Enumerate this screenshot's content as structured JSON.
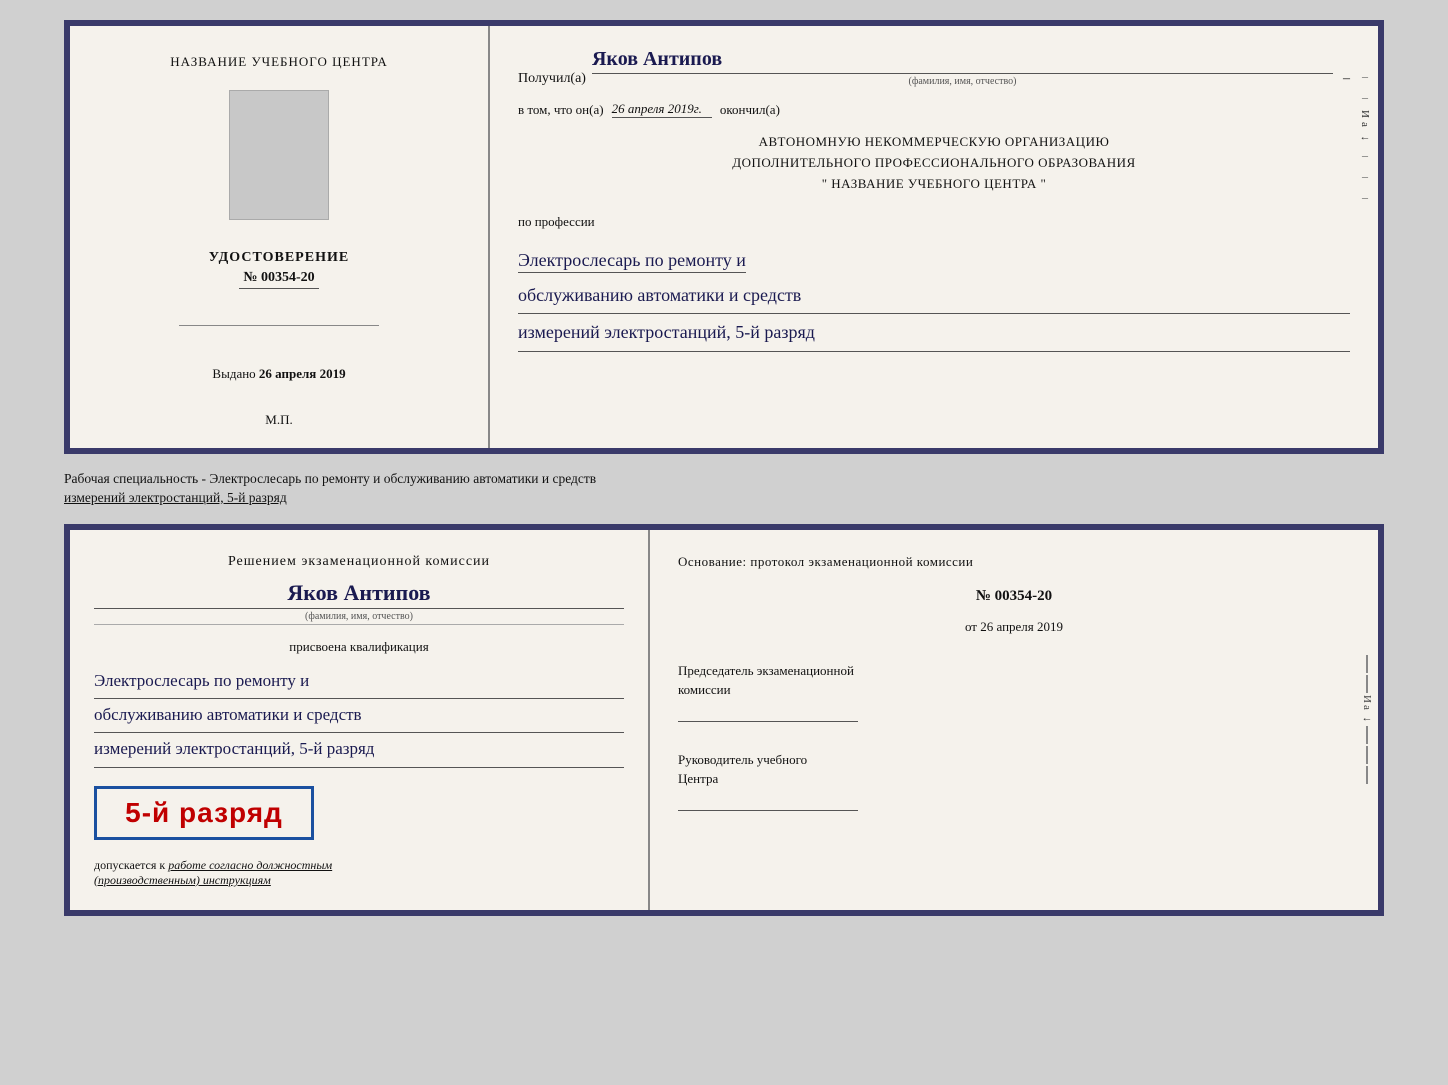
{
  "top_left": {
    "center_title": "НАЗВАНИЕ УЧЕБНОГО ЦЕНТРА",
    "udostoverenie_label": "УДОСТОВЕРЕНИЕ",
    "udostoverenie_number": "№ 00354-20",
    "vydano_label": "Выдано",
    "vydano_date": "26 апреля 2019",
    "mp_label": "М.П."
  },
  "top_right": {
    "poluchil_label": "Получил(а)",
    "poluchil_name": "Яков Антипов",
    "fio_subtitle": "(фамилия, имя, отчество)",
    "vtom_prefix": "в том, что он(а)",
    "vtom_date": "26 апреля 2019г.",
    "vtom_suffix": "окончил(а)",
    "org_line1": "АВТОНОМНУЮ НЕКОММЕРЧЕСКУЮ ОРГАНИЗАЦИЮ",
    "org_line2": "ДОПОЛНИТЕЛЬНОГО ПРОФЕССИОНАЛЬНОГО ОБРАЗОВАНИЯ",
    "org_line3": "\"   НАЗВАНИЕ УЧЕБНОГО ЦЕНТРА   \"",
    "po_professii": "по профессии",
    "profession_line1": "Электрослесарь по ремонту и",
    "profession_line2": "обслуживанию автоматики и средств",
    "profession_line3": "измерений электростанций, 5-й разряд",
    "deco_chars": [
      "И",
      "а",
      "←"
    ]
  },
  "middle_text": {
    "line1": "Рабочая специальность - Электрослесарь по ремонту и обслуживанию автоматики и средств",
    "line2": "измерений электростанций, 5-й разряд"
  },
  "bottom_left": {
    "decision_title": "Решением экзаменационной комиссии",
    "name": "Яков Антипов",
    "fio_label": "(фамилия, имя, отчество)",
    "prisvoena": "присвоена квалификация",
    "qual_line1": "Электрослесарь по ремонту и",
    "qual_line2": "обслуживанию автоматики и средств",
    "qual_line3": "измерений электростанций, 5-й разряд",
    "razryad_text": "5-й разряд",
    "dopuskaetsya_prefix": "допускается к",
    "dopuskaetsya_italic": "работе согласно должностным",
    "dopuskaetsya_italic2": "(производственным) инструкциям"
  },
  "bottom_right": {
    "osnovaniye": "Основание: протокол экзаменационной комиссии",
    "protocol_number": "№  00354-20",
    "ot_label": "от",
    "ot_date": "26 апреля 2019",
    "chairman_line1": "Председатель экзаменационной",
    "chairman_line2": "комиссии",
    "rukov_line1": "Руководитель учебного",
    "rukov_line2": "Центра",
    "deco_chars": [
      "И",
      "а",
      "←"
    ]
  }
}
